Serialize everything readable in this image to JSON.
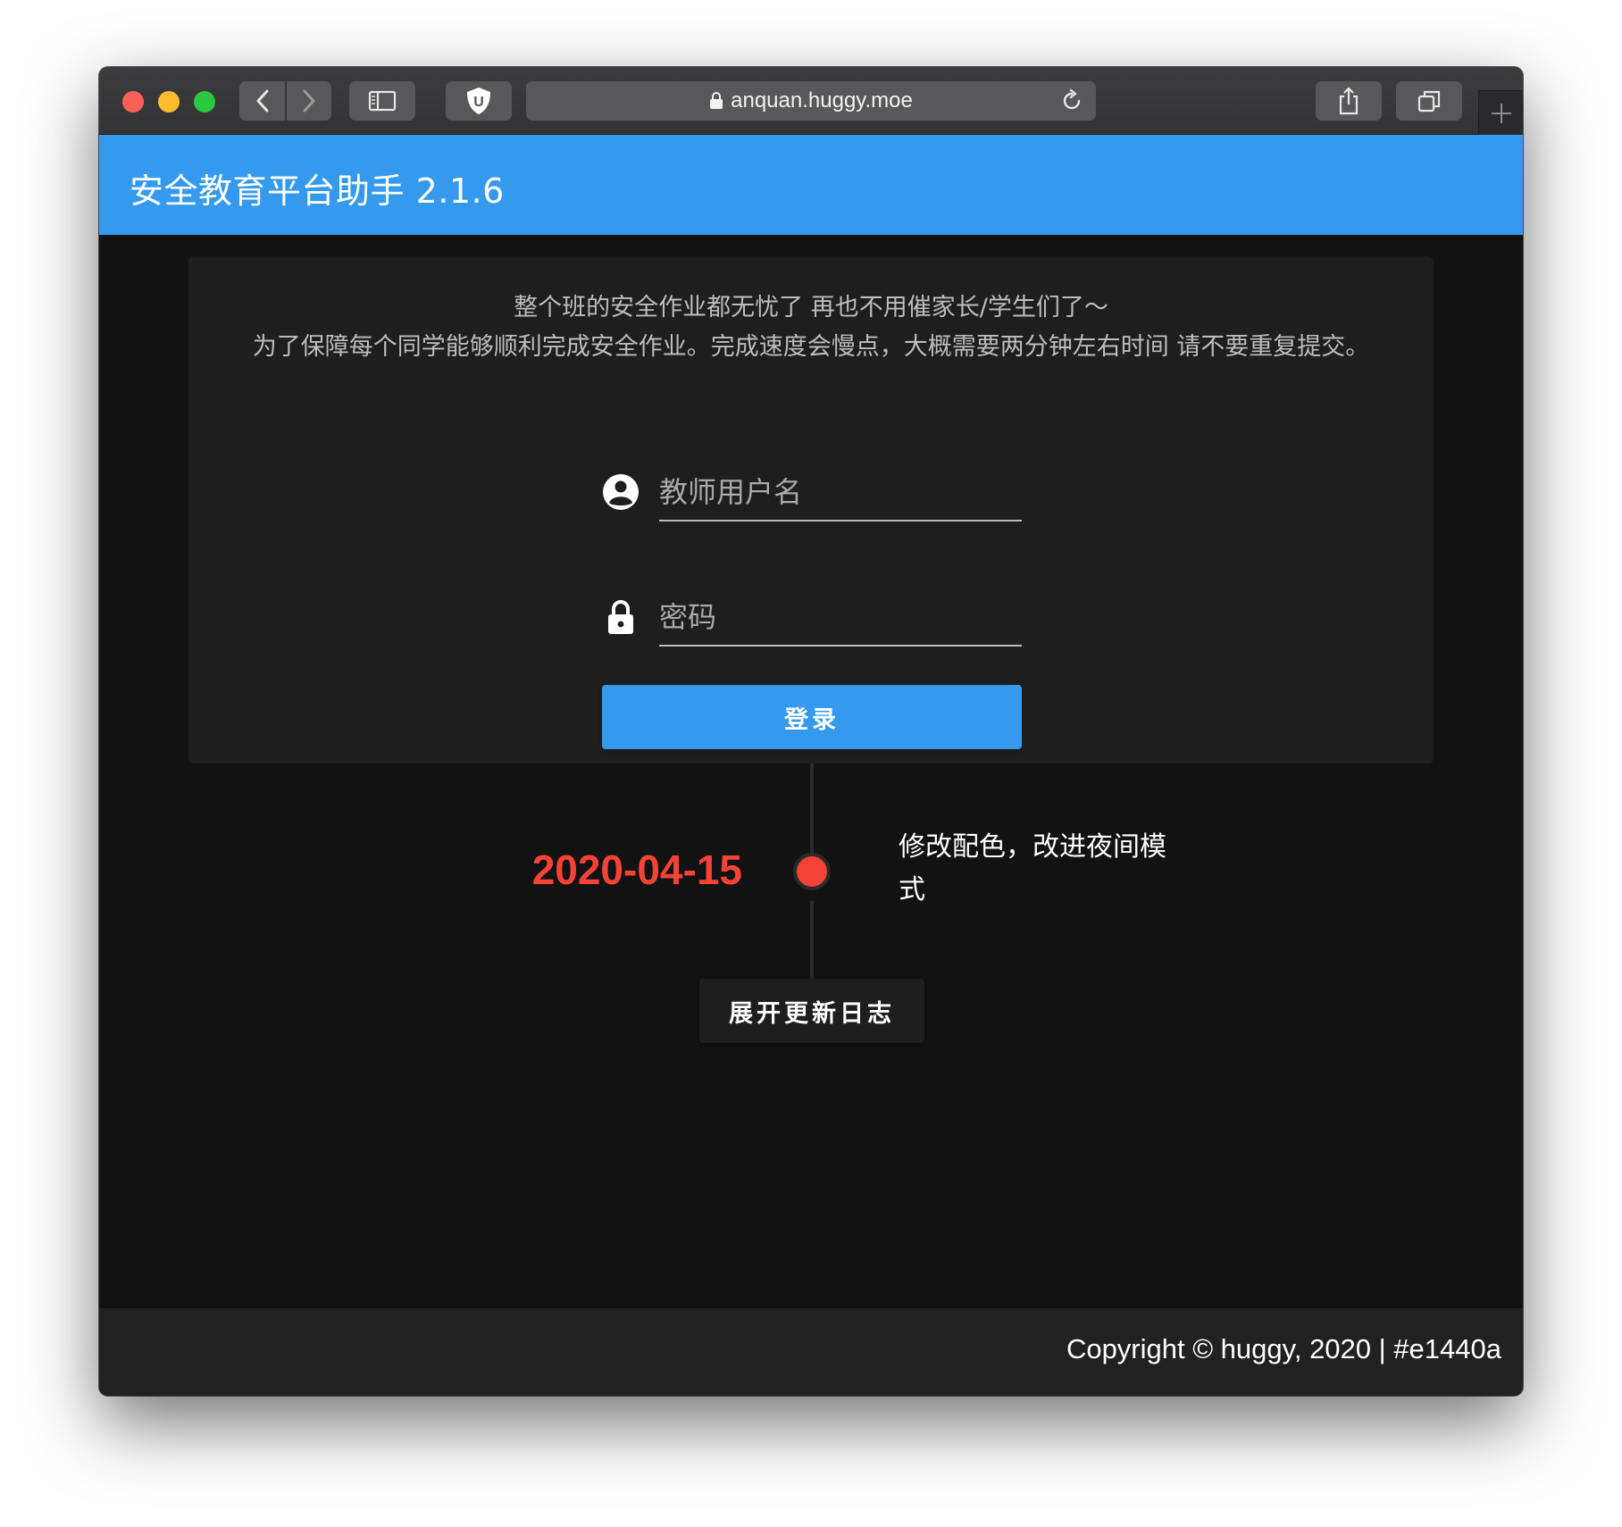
{
  "browser": {
    "url": "anquan.huggy.moe",
    "icons": {
      "back": "chevron-left-icon",
      "forward": "chevron-right-icon",
      "sidebar": "sidebar-icon",
      "extension": "ublock-shield-icon",
      "extension_letter": "U",
      "lock": "lock-icon",
      "reload": "reload-icon",
      "share": "share-icon",
      "tabs": "tabs-overview-icon",
      "new_tab": "plus-icon"
    }
  },
  "header": {
    "title": "安全教育平台助手 2.1.6",
    "bg_color": "#359aed"
  },
  "intro": {
    "line1": "整个班的安全作业都无忧了 再也不用催家长/学生们了～",
    "line2": "为了保障每个同学能够顺利完成安全作业。完成速度会慢点，大概需要两分钟左右时间 请不要重复提交。"
  },
  "login_form": {
    "username_placeholder": "教师用户名",
    "username_value": "",
    "username_icon": "account-circle-icon",
    "password_placeholder": "密码",
    "password_value": "",
    "password_icon": "lock-icon",
    "submit_label": "登录",
    "accent": "#359aed"
  },
  "timeline": {
    "date": "2020-04-15",
    "note": "修改配色，改进夜间模式",
    "dot_color": "#f44336",
    "expand_label": "展开更新日志"
  },
  "footer": {
    "copyright": "Copyright © huggy, 2020 | #e1440a"
  }
}
